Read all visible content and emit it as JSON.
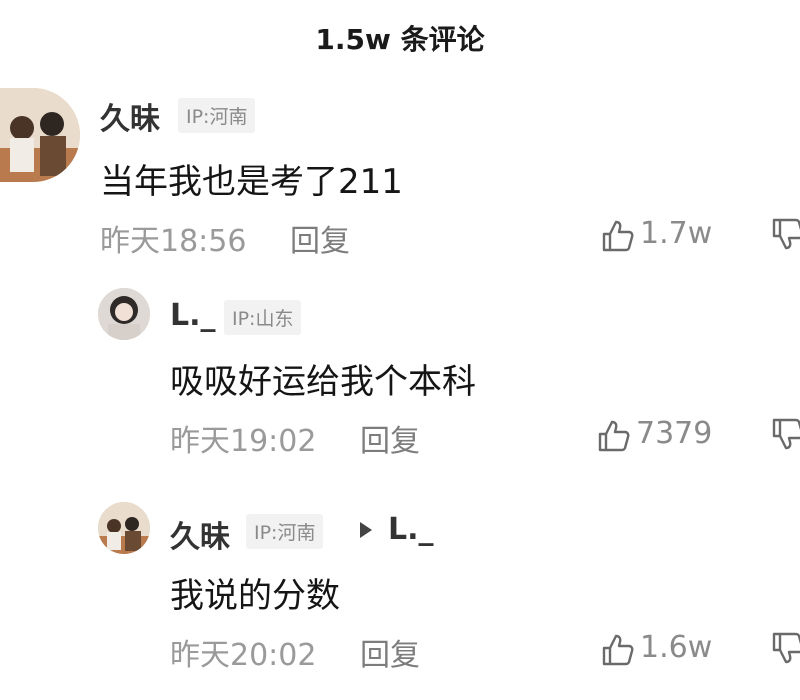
{
  "header": {
    "title": "1.5w 条评论"
  },
  "comments": [
    {
      "username": "久昧",
      "ip": "IP:河南",
      "text": "当年我也是考了211",
      "time": "昨天18:56",
      "reply_label": "回复",
      "likes": "1.7w"
    },
    {
      "username": "L._",
      "ip": "IP:山东",
      "text": "吸吸好运给我个本科",
      "time": "昨天19:02",
      "reply_label": "回复",
      "likes": "7379"
    },
    {
      "username": "久昧",
      "ip": "IP:河南",
      "reply_to": "L._",
      "text": "我说的分数",
      "time": "昨天20:02",
      "reply_label": "回复",
      "likes": "1.6w"
    }
  ],
  "icons": {
    "like": "thumbs-up-icon",
    "dislike": "thumbs-down-icon",
    "reply_arrow": "triangle-right-icon"
  },
  "colors": {
    "username": "#333333",
    "meta": "#9a9a9a",
    "badge_bg": "#f2f2f2"
  }
}
